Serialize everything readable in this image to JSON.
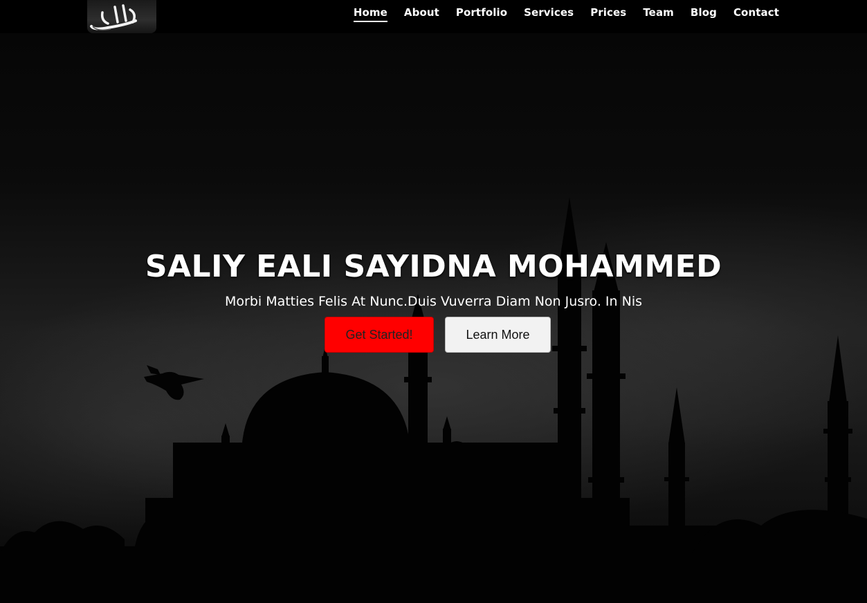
{
  "header": {
    "logo_alt": "Allah calligraphy logo",
    "nav": [
      {
        "label": "Home",
        "active": true
      },
      {
        "label": "About",
        "active": false
      },
      {
        "label": "Portfolio",
        "active": false
      },
      {
        "label": "Services",
        "active": false
      },
      {
        "label": "Prices",
        "active": false
      },
      {
        "label": "Team",
        "active": false
      },
      {
        "label": "Blog",
        "active": false
      },
      {
        "label": "Contact",
        "active": false
      }
    ]
  },
  "hero": {
    "title": "SALIY EALI SAYIDNA MOHAMMED",
    "subtitle": "Morbi Matties Felis At Nunc.Duis Vuverra Diam Non Jusro. In Nis",
    "primary_button": "Get Started!",
    "secondary_button": "Learn More",
    "background": "mosque-silhouette-night"
  },
  "colors": {
    "accent": "#ff0000",
    "text": "#ffffff",
    "background": "#000000"
  }
}
